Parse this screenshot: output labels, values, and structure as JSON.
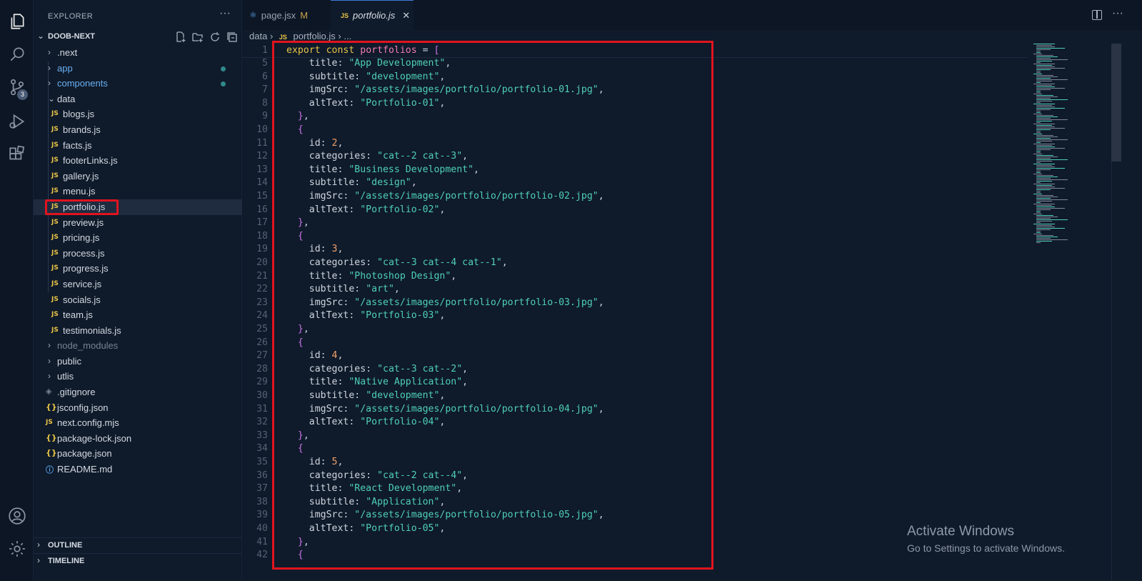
{
  "sidebar": {
    "header": "EXPLORER",
    "more": "···",
    "project": "DOOB-NEXT",
    "tree": [
      {
        "label": ".next",
        "type": "folder",
        "level": 1,
        "color": "normal"
      },
      {
        "label": "app",
        "type": "folder",
        "level": 1,
        "color": "blue",
        "dot": true
      },
      {
        "label": "components",
        "type": "folder",
        "level": 1,
        "color": "blue",
        "dot": true
      },
      {
        "label": "data",
        "type": "folder-open",
        "level": 1,
        "color": "normal"
      },
      {
        "label": "blogs.js",
        "type": "js",
        "level": 2
      },
      {
        "label": "brands.js",
        "type": "js",
        "level": 2
      },
      {
        "label": "facts.js",
        "type": "js",
        "level": 2
      },
      {
        "label": "footerLinks.js",
        "type": "js",
        "level": 2
      },
      {
        "label": "gallery.js",
        "type": "js",
        "level": 2
      },
      {
        "label": "menu.js",
        "type": "js",
        "level": 2
      },
      {
        "label": "portfolio.js",
        "type": "js",
        "level": 2,
        "selected": true
      },
      {
        "label": "preview.js",
        "type": "js",
        "level": 2
      },
      {
        "label": "pricing.js",
        "type": "js",
        "level": 2
      },
      {
        "label": "process.js",
        "type": "js",
        "level": 2
      },
      {
        "label": "progress.js",
        "type": "js",
        "level": 2
      },
      {
        "label": "service.js",
        "type": "js",
        "level": 2
      },
      {
        "label": "socials.js",
        "type": "js",
        "level": 2
      },
      {
        "label": "team.js",
        "type": "js",
        "level": 2
      },
      {
        "label": "testimonials.js",
        "type": "js",
        "level": 2
      },
      {
        "label": "node_modules",
        "type": "folder",
        "level": 1,
        "color": "dim"
      },
      {
        "label": "public",
        "type": "folder",
        "level": 1,
        "color": "normal"
      },
      {
        "label": "utlis",
        "type": "folder",
        "level": 1,
        "color": "normal"
      },
      {
        "label": ".gitignore",
        "type": "git",
        "level": 1
      },
      {
        "label": "jsconfig.json",
        "type": "json",
        "level": 1
      },
      {
        "label": "next.config.mjs",
        "type": "js",
        "level": 1
      },
      {
        "label": "package-lock.json",
        "type": "json",
        "level": 1
      },
      {
        "label": "package.json",
        "type": "json",
        "level": 1
      },
      {
        "label": "README.md",
        "type": "info",
        "level": 1
      }
    ],
    "panels": [
      "OUTLINE",
      "TIMELINE"
    ]
  },
  "activity": {
    "source_control_badge": "3"
  },
  "tabs": [
    {
      "label": "page.jsx",
      "status": "M"
    },
    {
      "label": "portfolio.js",
      "close": "✕"
    }
  ],
  "breadcrumb": {
    "folder": "data",
    "file": "portfolio.js",
    "rest": "..."
  },
  "code": {
    "sticky": {
      "num": "1",
      "text": "export const portfolios = ["
    },
    "first_visible_line": 5,
    "lines": [
      {
        "i": 2,
        "p": "title",
        "v": "\"App Development\""
      },
      {
        "i": 2,
        "p": "subtitle",
        "v": "\"development\""
      },
      {
        "i": 2,
        "p": "imgSrc",
        "v": "\"/assets/images/portfolio/portfolio-01.jpg\""
      },
      {
        "i": 2,
        "p": "altText",
        "v": "\"Portfolio-01\""
      },
      {
        "i": 1,
        "close": true
      },
      {
        "i": 1,
        "open": true
      },
      {
        "i": 2,
        "p": "id",
        "n": "2"
      },
      {
        "i": 2,
        "p": "categories",
        "v": "\"cat--2 cat--3\""
      },
      {
        "i": 2,
        "p": "title",
        "v": "\"Business Development\""
      },
      {
        "i": 2,
        "p": "subtitle",
        "v": "\"design\""
      },
      {
        "i": 2,
        "p": "imgSrc",
        "v": "\"/assets/images/portfolio/portfolio-02.jpg\""
      },
      {
        "i": 2,
        "p": "altText",
        "v": "\"Portfolio-02\""
      },
      {
        "i": 1,
        "close": true
      },
      {
        "i": 1,
        "open": true
      },
      {
        "i": 2,
        "p": "id",
        "n": "3"
      },
      {
        "i": 2,
        "p": "categories",
        "v": "\"cat--3 cat--4 cat--1\""
      },
      {
        "i": 2,
        "p": "title",
        "v": "\"Photoshop Design\""
      },
      {
        "i": 2,
        "p": "subtitle",
        "v": "\"art\""
      },
      {
        "i": 2,
        "p": "imgSrc",
        "v": "\"/assets/images/portfolio/portfolio-03.jpg\""
      },
      {
        "i": 2,
        "p": "altText",
        "v": "\"Portfolio-03\""
      },
      {
        "i": 1,
        "close": true
      },
      {
        "i": 1,
        "open": true
      },
      {
        "i": 2,
        "p": "id",
        "n": "4"
      },
      {
        "i": 2,
        "p": "categories",
        "v": "\"cat--3 cat--2\""
      },
      {
        "i": 2,
        "p": "title",
        "v": "\"Native Application\""
      },
      {
        "i": 2,
        "p": "subtitle",
        "v": "\"development\""
      },
      {
        "i": 2,
        "p": "imgSrc",
        "v": "\"/assets/images/portfolio/portfolio-04.jpg\""
      },
      {
        "i": 2,
        "p": "altText",
        "v": "\"Portfolio-04\""
      },
      {
        "i": 1,
        "close": true
      },
      {
        "i": 1,
        "open": true
      },
      {
        "i": 2,
        "p": "id",
        "n": "5"
      },
      {
        "i": 2,
        "p": "categories",
        "v": "\"cat--2 cat--4\""
      },
      {
        "i": 2,
        "p": "title",
        "v": "\"React Development\""
      },
      {
        "i": 2,
        "p": "subtitle",
        "v": "\"Application\""
      },
      {
        "i": 2,
        "p": "imgSrc",
        "v": "\"/assets/images/portfolio/portfolio-05.jpg\""
      },
      {
        "i": 2,
        "p": "altText",
        "v": "\"Portfolio-05\""
      },
      {
        "i": 1,
        "close": true
      },
      {
        "i": 1,
        "open": true
      }
    ]
  },
  "watermark": {
    "title": "Activate Windows",
    "subtitle": "Go to Settings to activate Windows."
  },
  "colors": {
    "highlight": "#e0141f",
    "keyword": "#e8c547",
    "string": "#4fd0b5",
    "number": "#f0a06a",
    "bracket": "#c874e8"
  }
}
